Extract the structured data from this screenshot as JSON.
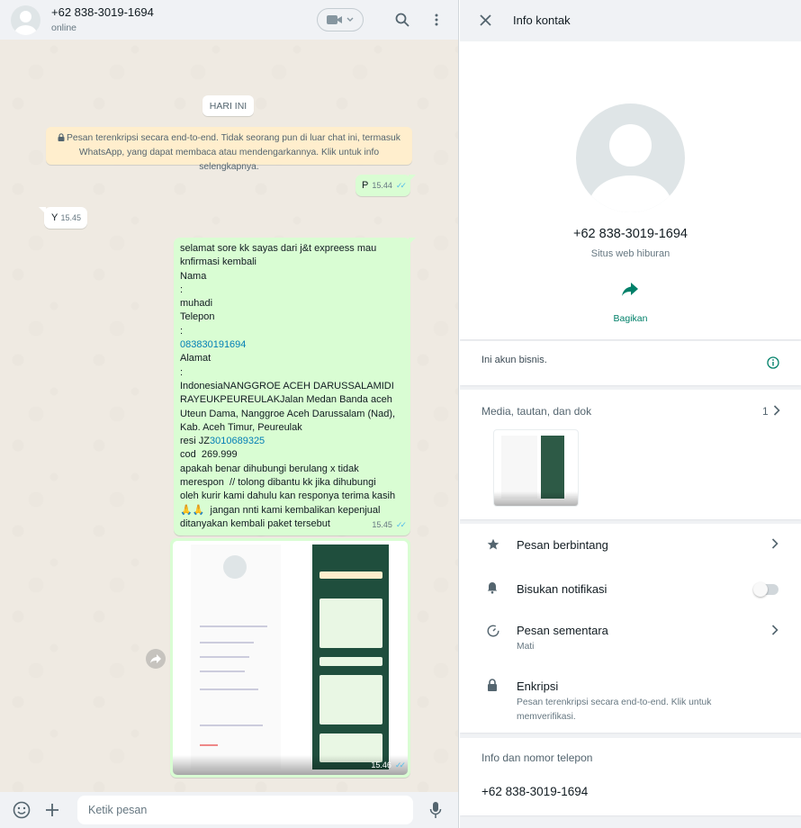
{
  "chat": {
    "header": {
      "name": "+62 838-3019-1694",
      "status": "online",
      "icons": [
        "video-call-icon",
        "search-icon",
        "menu-icon"
      ]
    },
    "date_chip": "HARI INI",
    "e2e_notice": "Pesan terenkripsi secara end-to-end. Tidak seorang pun di luar chat ini, termasuk WhatsApp, yang dapat membaca atau mendengarkannya. Klik untuk info selengkapnya.",
    "messages": [
      {
        "direction": "out",
        "text": "P",
        "time": "15.44",
        "read": true
      },
      {
        "direction": "in",
        "text": "Y",
        "time": "15.45"
      },
      {
        "direction": "out",
        "time": "15.45",
        "read": true,
        "lines": [
          "selamat sore kk sayas dari j&t expreess mau",
          "knfirmasi kembali",
          "Nama",
          ":",
          "muhadi",
          "Telepon",
          ":",
          "083830191694",
          "Alamat",
          ":",
          "IndonesiaNANGGROE ACEH DARUSSALAMIDI",
          "RAYEUKPEUREULAKJalan Medan Banda aceh",
          "Uteun Dama, Nanggroe Aceh Darussalam (Nad),",
          "Kab. Aceh Timur, Peureulak",
          "resi JZ3010689325",
          "cod  269.999",
          "apakah benar dihubungi berulang x tidak",
          "merespon  // tolong dibantu kk jika dihubungi",
          "oleh kurir kami dahulu kan responya terima kasih",
          "🙏🙏  jangan nnti kami kembalikan kepenjual",
          "ditanyakan kembali paket tersebut"
        ]
      },
      {
        "direction": "out",
        "type": "image",
        "time": "15.46",
        "read": true
      }
    ],
    "composer": {
      "placeholder": "Ketik pesan"
    }
  },
  "info": {
    "title": "Info kontak",
    "phone": "+62 838-3019-1694",
    "subtitle": "Situs web hiburan",
    "share_label": "Bagikan",
    "business_note": "Ini akun bisnis.",
    "media_label": "Media, tautan, dan dok",
    "media_count": "1",
    "rows": {
      "starred": "Pesan berbintang",
      "mute": "Bisukan notifikasi",
      "mute_on": false,
      "disappearing": "Pesan sementara",
      "disappearing_value": "Mati",
      "encryption": "Enkripsi",
      "encryption_desc_1": "Pesan terenkripsi secara end-to-end. Klik untuk",
      "encryption_desc_2": "memverifikasi."
    },
    "about_label": "Info dan nomor telepon",
    "about_value": "+62 838-3019-1694"
  },
  "colors": {
    "accent": "#008069",
    "outgoing": "#d9fdd3",
    "link": "#027eb5",
    "read_ticks": "#53bdeb"
  }
}
